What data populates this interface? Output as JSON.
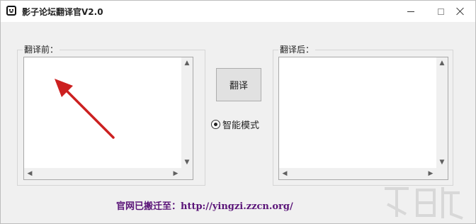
{
  "window": {
    "title": "影子论坛翻译官V2.0"
  },
  "left_group": {
    "legend": "翻译前：",
    "text": ""
  },
  "right_group": {
    "legend": "翻译后：",
    "text": ""
  },
  "translate_button": {
    "label": "翻译"
  },
  "mode_radio": {
    "label": "智能模式",
    "checked": true
  },
  "footer": {
    "site_text": "官网已搬迁至：http://yingzi.zzcn.org/"
  },
  "colors": {
    "footer_text": "#5a1478",
    "arrow": "#cc2020"
  },
  "icons": {
    "app": "smiley-app-icon",
    "minimize": "minimize-icon",
    "maximize": "maximize-icon",
    "close": "close-icon"
  }
}
